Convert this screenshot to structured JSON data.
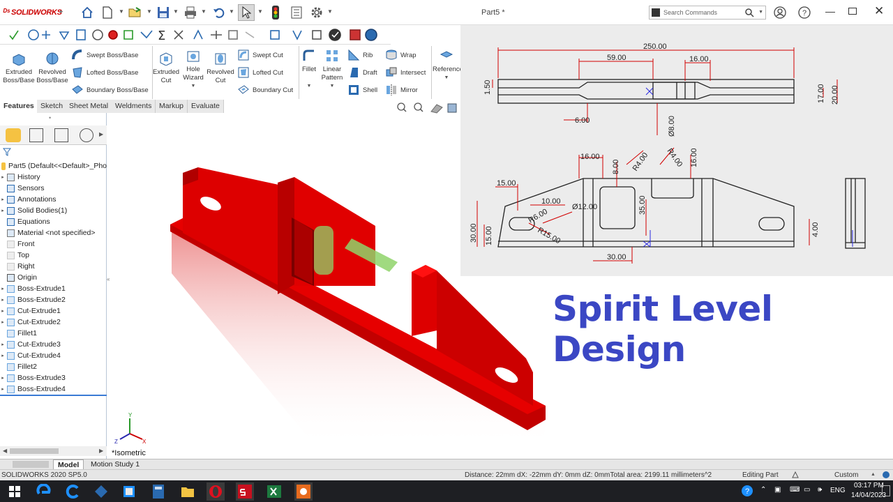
{
  "app": {
    "logo_text": "SOLIDWORKS",
    "doc_title": "Part5 *"
  },
  "search": {
    "placeholder": "Search Commands"
  },
  "features": {
    "extruded_boss": "Extruded Boss/Base",
    "revolved_boss": "Revolved Boss/Base",
    "swept_boss": "Swept Boss/Base",
    "lofted_boss": "Lofted Boss/Base",
    "boundary_boss": "Boundary Boss/Base",
    "extruded_cut": "Extruded Cut",
    "hole_wizard": "Hole Wizard",
    "revolved_cut": "Revolved Cut",
    "swept_cut": "Swept Cut",
    "lofted_cut": "Lofted Cut",
    "boundary_cut": "Boundary Cut",
    "fillet": "Fillet",
    "linear_pattern": "Linear Pattern",
    "rib": "Rib",
    "draft": "Draft",
    "shell": "Shell",
    "wrap": "Wrap",
    "intersect": "Intersect",
    "mirror": "Mirror",
    "reference_geometry": "Reference Geometry"
  },
  "tabs": [
    "Features",
    "Sketch",
    "Sheet Metal",
    "Weldments",
    "Markup",
    "Evaluate"
  ],
  "tree": {
    "root": "Part5  (Default<<Default>_Pho",
    "items": [
      {
        "label": "History",
        "exp": true,
        "icon": "history-icon"
      },
      {
        "label": "Sensors",
        "exp": false,
        "icon": "sensor-icon"
      },
      {
        "label": "Annotations",
        "exp": true,
        "icon": "annotation-icon"
      },
      {
        "label": "Solid Bodies(1)",
        "exp": true,
        "icon": "solid-body-icon"
      },
      {
        "label": "Equations",
        "exp": false,
        "icon": "equation-icon"
      },
      {
        "label": "Material <not specified>",
        "exp": false,
        "icon": "material-icon"
      },
      {
        "label": "Front",
        "exp": false,
        "icon": "plane-icon"
      },
      {
        "label": "Top",
        "exp": false,
        "icon": "plane-icon"
      },
      {
        "label": "Right",
        "exp": false,
        "icon": "plane-icon"
      },
      {
        "label": "Origin",
        "exp": false,
        "icon": "origin-icon"
      },
      {
        "label": "Boss-Extrude1",
        "exp": true,
        "icon": "extrude-icon"
      },
      {
        "label": "Boss-Extrude2",
        "exp": true,
        "icon": "extrude-icon"
      },
      {
        "label": "Cut-Extrude1",
        "exp": true,
        "icon": "cut-icon"
      },
      {
        "label": "Cut-Extrude2",
        "exp": true,
        "icon": "cut-icon"
      },
      {
        "label": "Fillet1",
        "exp": false,
        "icon": "fillet-icon"
      },
      {
        "label": "Cut-Extrude3",
        "exp": true,
        "icon": "cut-icon"
      },
      {
        "label": "Cut-Extrude4",
        "exp": true,
        "icon": "cut-icon"
      },
      {
        "label": "Fillet2",
        "exp": false,
        "icon": "fillet-icon"
      },
      {
        "label": "Boss-Extrude3",
        "exp": true,
        "icon": "extrude-icon"
      },
      {
        "label": "Boss-Extrude4",
        "exp": true,
        "icon": "extrude-icon"
      }
    ]
  },
  "drawing": {
    "top_view": {
      "overall": "250.00",
      "left_len": "59.00",
      "slot_w": "16.00",
      "thin": "1.50",
      "height_inner": "17.00",
      "height_outer": "20.00",
      "step": "6.00",
      "dia": "Ø8.00"
    },
    "front_view": {
      "d16a": "16.00",
      "d8": "8.00",
      "r4a": "R4.00",
      "r4b": "R4.00",
      "d16b": "16.00",
      "d15a": "15.00",
      "d10": "10.00",
      "r6": "R6.00",
      "r15": "R15.00",
      "dia12": "Ø12.00",
      "d35": "35.00",
      "d30v": "30.00",
      "d15b": "15.00",
      "d30h": "30.00",
      "d4": "4.00"
    }
  },
  "banner": "Spirit Level Design",
  "view_label": "*Isometric",
  "bottom_tabs": [
    "Model",
    "Motion Study 1"
  ],
  "status": {
    "version": "SOLIDWORKS 2020 SP5.0",
    "measure": "Distance: 22mm   dX: -22mm   dY: 0mm   dZ: 0mmTotal area: 2199.11 millimeters^2",
    "mode": "Editing Part",
    "units": "Custom"
  },
  "taskbar": {
    "lang": "ENG",
    "time": "03:17 PM",
    "date": "14/04/2023"
  },
  "colors": {
    "part_red": "#d40000",
    "banner_blue": "#3b47c4",
    "bubble_green": "#8fd36a"
  }
}
